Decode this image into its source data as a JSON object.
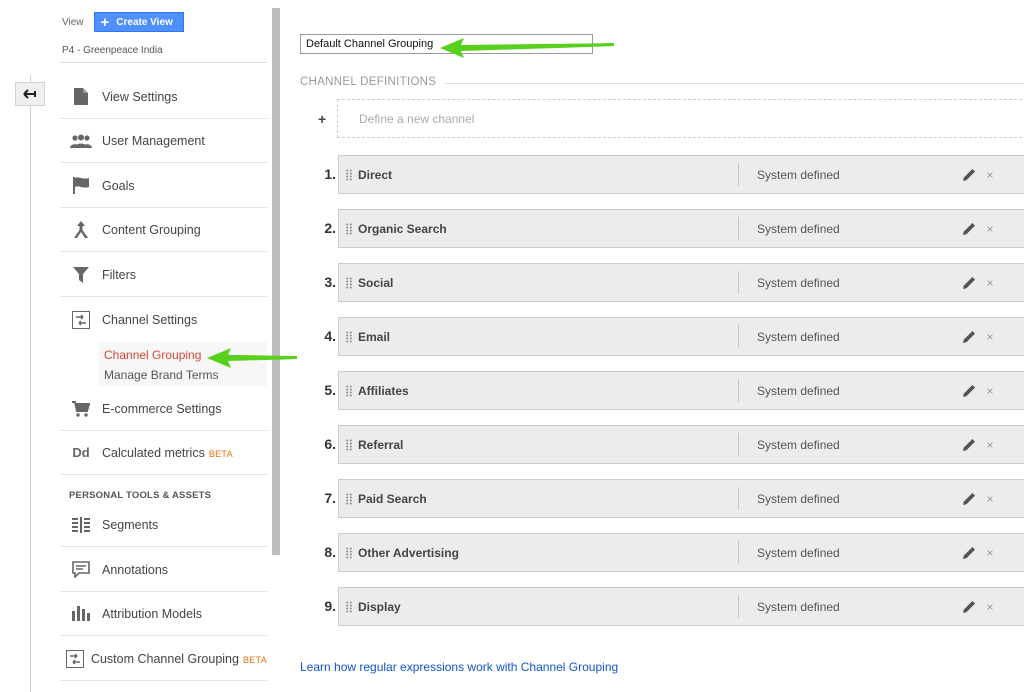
{
  "sidebar": {
    "view_label": "View",
    "create_view_label": "Create View",
    "view_name": "P4 - Greenpeace India",
    "items": [
      {
        "label": "View Settings",
        "icon": "document-icon"
      },
      {
        "label": "User Management",
        "icon": "users-icon"
      },
      {
        "label": "Goals",
        "icon": "flag-icon"
      },
      {
        "label": "Content Grouping",
        "icon": "content-grouping-icon"
      },
      {
        "label": "Filters",
        "icon": "filter-icon"
      },
      {
        "label": "Channel Settings",
        "icon": "channel-settings-icon"
      },
      {
        "label": "E-commerce Settings",
        "icon": "cart-icon"
      },
      {
        "label": "Calculated metrics",
        "icon": "dd-icon",
        "badge": "BETA"
      },
      {
        "label": "Segments",
        "icon": "segments-icon"
      },
      {
        "label": "Annotations",
        "icon": "annotation-icon"
      },
      {
        "label": "Attribution Models",
        "icon": "bar-chart-icon"
      },
      {
        "label": "Custom Channel Grouping",
        "icon": "custom-channel-icon",
        "badge": "BETA"
      }
    ],
    "sub_items": {
      "channel_grouping": "Channel Grouping",
      "manage_brand_terms": "Manage Brand Terms"
    },
    "section_personal": "PERSONAL TOOLS & ASSETS"
  },
  "main": {
    "grouping_name": "Default Channel Grouping",
    "definitions_heading": "CHANNEL DEFINITIONS",
    "add_symbol": "+",
    "define_new": "Define a new channel",
    "channels": [
      {
        "num": "1.",
        "name": "Direct",
        "type": "System defined"
      },
      {
        "num": "2.",
        "name": "Organic Search",
        "type": "System defined"
      },
      {
        "num": "3.",
        "name": "Social",
        "type": "System defined"
      },
      {
        "num": "4.",
        "name": "Email",
        "type": "System defined"
      },
      {
        "num": "5.",
        "name": "Affiliates",
        "type": "System defined"
      },
      {
        "num": "6.",
        "name": "Referral",
        "type": "System defined"
      },
      {
        "num": "7.",
        "name": "Paid Search",
        "type": "System defined"
      },
      {
        "num": "8.",
        "name": "Other Advertising",
        "type": "System defined"
      },
      {
        "num": "9.",
        "name": "Display",
        "type": "System defined"
      }
    ],
    "delete_symbol": "×",
    "learn_link": "Learn how regular expressions work with Channel Grouping"
  },
  "colors": {
    "accent_blue": "#4d90fe",
    "active_red": "#d14836",
    "arrow_green": "#5ad01e",
    "link_blue": "#1155cc"
  }
}
